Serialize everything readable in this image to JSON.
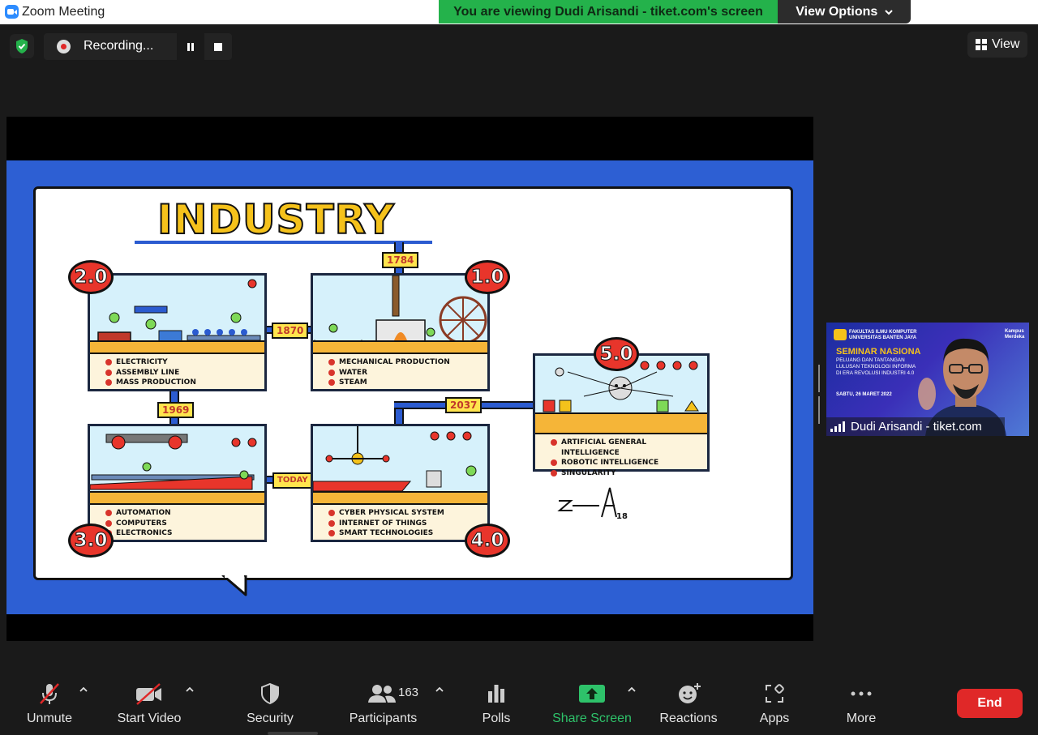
{
  "window": {
    "title": "Zoom Meeting"
  },
  "banner": {
    "text": "You are viewing Dudi Arisandi - tiket.com's screen",
    "view_options": "View Options"
  },
  "recording": {
    "label": "Recording..."
  },
  "view_button": {
    "label": "View"
  },
  "slide": {
    "title": "INDUSTRY",
    "years": {
      "y1784": "1784",
      "y1870": "1870",
      "y1969": "1969",
      "y2037": "2037",
      "today": "TODAY"
    },
    "stages": {
      "s1": {
        "badge": "1.0",
        "items": [
          "Mechanical Production",
          "Water",
          "Steam"
        ]
      },
      "s2": {
        "badge": "2.0",
        "items": [
          "Electricity",
          "Assembly Line",
          "Mass Production"
        ]
      },
      "s3": {
        "badge": "3.0",
        "items": [
          "Automation",
          "Computers",
          "Electronics"
        ]
      },
      "s4": {
        "badge": "4.0",
        "items": [
          "Cyber Physical System",
          "Internet of Things",
          "Smart Technologies"
        ]
      },
      "s5": {
        "badge": "5.0",
        "items": [
          "Artificial General Intelligence",
          "Robotic Intelligence",
          "Singularity"
        ]
      }
    },
    "signature_mark": "18",
    "colors": {
      "slide_bg": "#2d5fd3",
      "floor": "#f5b538",
      "badge": "#e8352b",
      "sky": "#d6f1fb",
      "tag": "#ffe44d"
    }
  },
  "participant": {
    "name": "Dudi Arisandi - tiket.com",
    "background": {
      "university": [
        "FAKULTAS ILMU KOMPUTER",
        "UNIVERSITAS BANTEN JAYA"
      ],
      "partner": [
        "Kampus",
        "Merdeka"
      ],
      "seminar": "SEMINAR NASIONA",
      "subtitle": [
        "PELUANG DAN TANTANGAN",
        "LULUSAN TEKNOLOGI INFORMA",
        "DI ERA REVOLUSI INDUSTRI 4.0"
      ],
      "date": "SABTU, 26 MARET 2022"
    }
  },
  "toolbar": {
    "unmute": "Unmute",
    "start_video": "Start Video",
    "security": "Security",
    "participants": "Participants",
    "participants_count": "163",
    "polls": "Polls",
    "share_screen": "Share Screen",
    "reactions": "Reactions",
    "apps": "Apps",
    "more": "More",
    "end": "End"
  },
  "icons": [
    "zoom-logo-icon",
    "shield-check-icon",
    "record-icon",
    "pause-icon",
    "stop-icon",
    "grid-view-icon",
    "microphone-muted-icon",
    "video-off-icon",
    "shield-icon",
    "participants-icon",
    "polls-icon",
    "share-screen-arrow-icon",
    "reactions-icon",
    "apps-icon",
    "more-dots-icon",
    "chevron-up-icon",
    "signal-icon"
  ],
  "status_colors": {
    "share_banner": "#24b24b",
    "end": "#e02828",
    "share_screen": "#2ec26a"
  }
}
